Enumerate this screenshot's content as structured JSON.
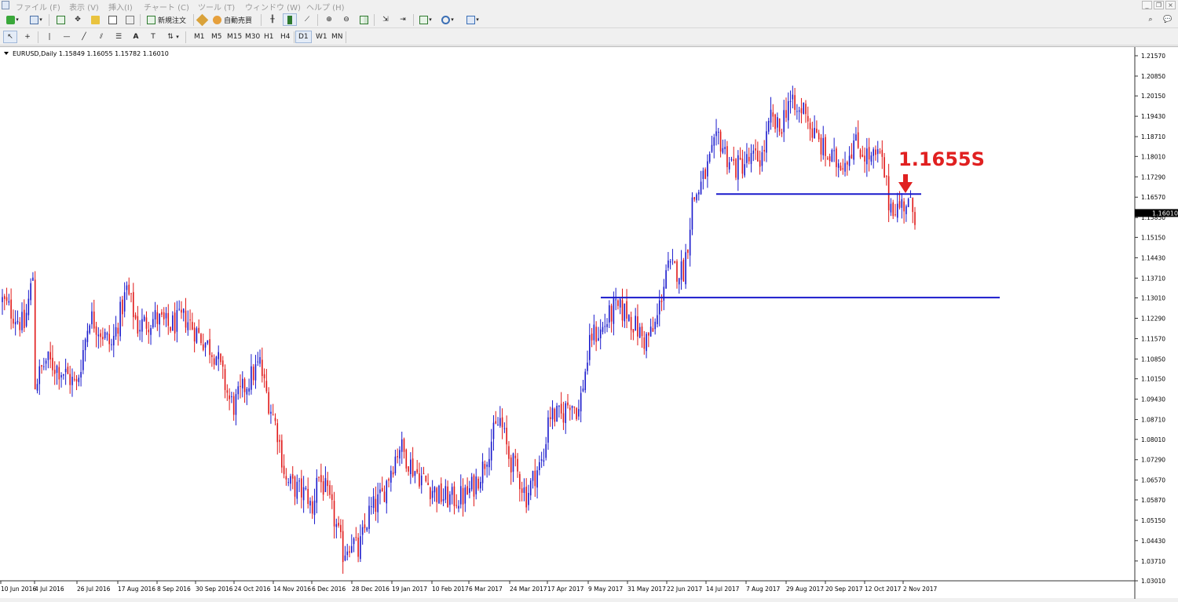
{
  "menu": {
    "items": [
      "ファイル (F)",
      "表示 (V)",
      "挿入(I)",
      "チャート (C)",
      "ツール (T)",
      "ウィンドウ (W)",
      "ヘルプ (H)"
    ]
  },
  "toolbar": {
    "new_order_label": "新規注文",
    "auto_trade_label": "自動売買",
    "timeframes": [
      "M1",
      "M5",
      "M15",
      "M30",
      "H1",
      "H4",
      "D1",
      "W1",
      "MN"
    ],
    "active_timeframe": "D1"
  },
  "chart": {
    "header": "EURUSD,Daily  1.15849 1.16055 1.15782 1.16010",
    "current_price_label": "1.16010",
    "annotation_text": "1.1655S"
  },
  "colors": {
    "bull": "#1a1acc",
    "bear": "#e01818",
    "trendline": "#1a1acc",
    "annotation": "#e02020",
    "background": "#ffffff"
  },
  "chart_data": {
    "type": "candlestick",
    "ylim": [
      1.0301,
      1.2157
    ],
    "y_ticks": [
      "1.21570",
      "1.20850",
      "1.20150",
      "1.19430",
      "1.18710",
      "1.18010",
      "1.17290",
      "1.16570",
      "1.15850",
      "1.15150",
      "1.14430",
      "1.13710",
      "1.13010",
      "1.12290",
      "1.11570",
      "1.10850",
      "1.10150",
      "1.09430",
      "1.08710",
      "1.08010",
      "1.07290",
      "1.06570",
      "1.05870",
      "1.05150",
      "1.04430",
      "1.03710",
      "1.03010"
    ],
    "x_ticks": [
      "10 Jun 2016",
      "4 Jul 2016",
      "26 Jul 2016",
      "17 Aug 2016",
      "8 Sep 2016",
      "30 Sep 2016",
      "24 Oct 2016",
      "14 Nov 2016",
      "6 Dec 2016",
      "28 Dec 2016",
      "19 Jan 2017",
      "10 Feb 2017",
      "6 Mar 2017",
      "24 Mar 2017",
      "17 Apr 2017",
      "9 May 2017",
      "31 May 2017",
      "22 Jun 2017",
      "14 Jul 2017",
      "7 Aug 2017",
      "29 Aug 2017",
      "20 Sep 2017",
      "12 Oct 2017",
      "2 Nov 2017"
    ],
    "close_path": [
      [
        0,
        1.129
      ],
      [
        10,
        1.12
      ],
      [
        14,
        1.138
      ],
      [
        15,
        1.1
      ],
      [
        20,
        1.108
      ],
      [
        28,
        1.104
      ],
      [
        34,
        1.099
      ],
      [
        40,
        1.124
      ],
      [
        50,
        1.113
      ],
      [
        57,
        1.133
      ],
      [
        62,
        1.12
      ],
      [
        70,
        1.123
      ],
      [
        76,
        1.12
      ],
      [
        84,
        1.123
      ],
      [
        90,
        1.117
      ],
      [
        98,
        1.11
      ],
      [
        104,
        1.094
      ],
      [
        106,
        1.092
      ],
      [
        112,
        1.1
      ],
      [
        118,
        1.107
      ],
      [
        120,
        1.099
      ],
      [
        126,
        1.083
      ],
      [
        130,
        1.065
      ],
      [
        136,
        1.062
      ],
      [
        140,
        1.06
      ],
      [
        142,
        1.053
      ],
      [
        144,
        1.068
      ],
      [
        148,
        1.062
      ],
      [
        152,
        1.052
      ],
      [
        156,
        1.04
      ],
      [
        160,
        1.045
      ],
      [
        163,
        1.04
      ],
      [
        168,
        1.054
      ],
      [
        174,
        1.06
      ],
      [
        178,
        1.07
      ],
      [
        182,
        1.078
      ],
      [
        188,
        1.07
      ],
      [
        194,
        1.065
      ],
      [
        200,
        1.06
      ],
      [
        206,
        1.059
      ],
      [
        212,
        1.06
      ],
      [
        216,
        1.064
      ],
      [
        220,
        1.07
      ],
      [
        224,
        1.08
      ],
      [
        228,
        1.087
      ],
      [
        232,
        1.074
      ],
      [
        236,
        1.068
      ],
      [
        240,
        1.06
      ],
      [
        244,
        1.068
      ],
      [
        248,
        1.073
      ],
      [
        250,
        1.089
      ],
      [
        256,
        1.088
      ],
      [
        260,
        1.094
      ],
      [
        264,
        1.09
      ],
      [
        266,
        1.1
      ],
      [
        270,
        1.117
      ],
      [
        274,
        1.118
      ],
      [
        280,
        1.126
      ],
      [
        286,
        1.125
      ],
      [
        290,
        1.12
      ],
      [
        294,
        1.115
      ],
      [
        298,
        1.118
      ],
      [
        300,
        1.123
      ],
      [
        304,
        1.14
      ],
      [
        308,
        1.14
      ],
      [
        312,
        1.14
      ],
      [
        314,
        1.15
      ],
      [
        316,
        1.164
      ],
      [
        320,
        1.17
      ],
      [
        324,
        1.178
      ],
      [
        328,
        1.187
      ],
      [
        332,
        1.18
      ],
      [
        336,
        1.176
      ],
      [
        340,
        1.178
      ],
      [
        344,
        1.179
      ],
      [
        348,
        1.18
      ],
      [
        352,
        1.193
      ],
      [
        356,
        1.189
      ],
      [
        360,
        1.2
      ],
      [
        364,
        1.195
      ],
      [
        368,
        1.198
      ],
      [
        370,
        1.19
      ],
      [
        374,
        1.185
      ],
      [
        378,
        1.18
      ],
      [
        382,
        1.178
      ],
      [
        386,
        1.179
      ],
      [
        390,
        1.185
      ],
      [
        394,
        1.182
      ],
      [
        398,
        1.179
      ],
      [
        402,
        1.18
      ],
      [
        404,
        1.174
      ],
      [
        406,
        1.164
      ],
      [
        410,
        1.162
      ],
      [
        414,
        1.164
      ],
      [
        418,
        1.1601
      ]
    ],
    "horizontal_levels": [
      {
        "value": 1.1668,
        "from": "14 Jul 2017",
        "to": "2 Nov 2017"
      },
      {
        "value": 1.1302,
        "from": "9 May 2017",
        "to": "2 Nov 2017"
      }
    ],
    "last_close": 1.1601
  }
}
